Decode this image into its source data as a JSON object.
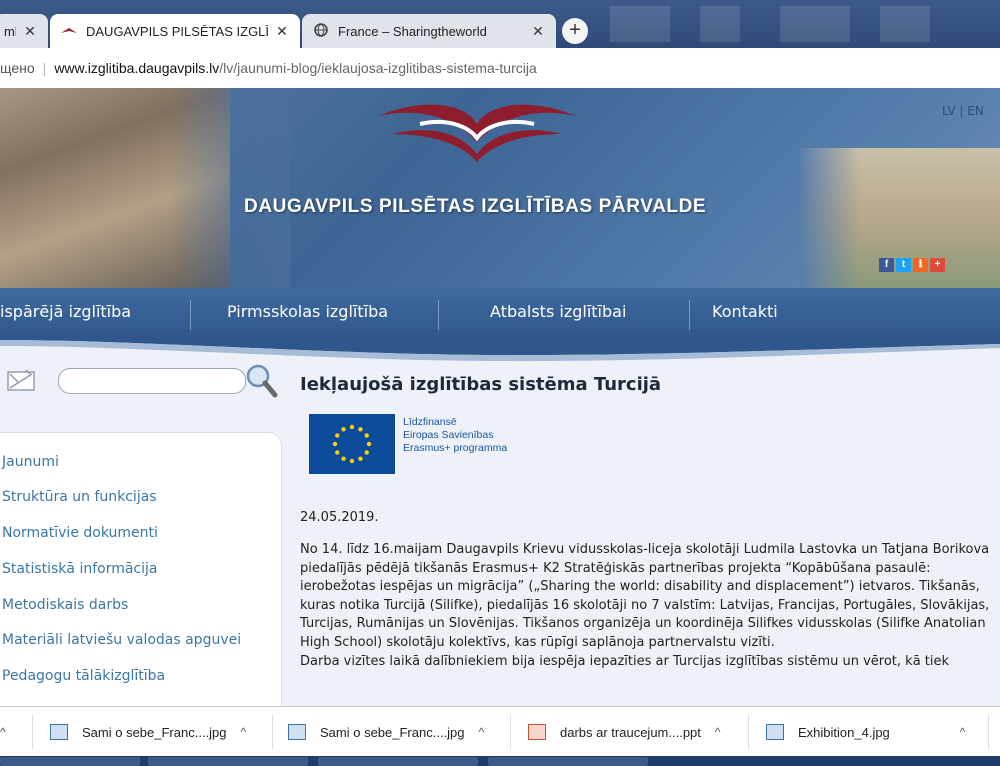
{
  "browser": {
    "tabs": [
      {
        "title": "mbc",
        "active": false
      },
      {
        "title": "DAUGAVPILS PILSĒTAS IZGLĪTĪBA",
        "active": true
      },
      {
        "title": "France – Sharingtheworld",
        "active": false
      }
    ],
    "new_tab": "+",
    "close_glyph": "✕"
  },
  "address": {
    "security": "щено",
    "host": "www.izglitiba.daugavpils.lv",
    "path": "/lv/jaunumi-blog/ieklaujosa-izglitibas-sistema-turcija"
  },
  "header": {
    "title": "DAUGAVPILS PILSĒTAS IZGLĪTĪBAS PĀRVALDE",
    "lang": "LV | EN",
    "social": [
      "f",
      "t",
      "ℹ",
      "+"
    ]
  },
  "nav": {
    "items": [
      "ispārējā izglītība",
      "Pirmsskolas izglītība",
      "Atbalsts izglītībai",
      "Kontakti"
    ]
  },
  "sidebar": {
    "items": [
      "Jaunumi",
      "Struktūra un funkcijas",
      "Normatīvie dokumenti",
      "Statistiskā informācija",
      "Metodiskais darbs",
      "Materiāli latviešu valodas apguvei",
      "Pedagogu tālākizglītība"
    ]
  },
  "article": {
    "title": "Iekļaujošā izglītības sistēma Turcijā",
    "eu_line1": "Līdzfinansē",
    "eu_line2": "Eiropas Savienības",
    "eu_line3": "Erasmus+ programma",
    "date": "24.05.2019.",
    "paragraph1": "No 14. līdz 16.maijam Daugavpils Krievu vidusskolas-liceja skolotāji Ludmila Lastovka un Tatjana Borikova piedalījās pēdējā tikšanās Erasmus+ K2 Stratēģiskās partnerības projekta “Kopābūšana pasaulē: ierobežotas iespējas un migrācija” („Sharing the world: disability and displacement”) ietvaros. Tikšanās, kuras notika Turcijā (Silifke), piedalījās 16 skolotāji no 7 valstīm:  Latvijas, Francijas, Portugāles, Slovākijas, Turcijas, Rumānijas un Slovēnijas.  Tikšanos organizēja un koordinēja Silifkes vidusskolas (Silifke Anatolian High School) skolotāju kolektīvs, kas  rūpīgi saplānoja partnervalstu vizīti.",
    "paragraph2": "Darba vizītes laikā dalībniekiem bija iespēja iepazīties ar Turcijas izglītības sistēmu un vērot, kā tiek"
  },
  "downloads": {
    "items": [
      "Sami o sebe_Franc....jpg",
      "Sami o sebe_Franc....jpg",
      "darbs ar traucejum....ppt",
      "Exhibition_4.jpg"
    ],
    "chevron": "^"
  }
}
